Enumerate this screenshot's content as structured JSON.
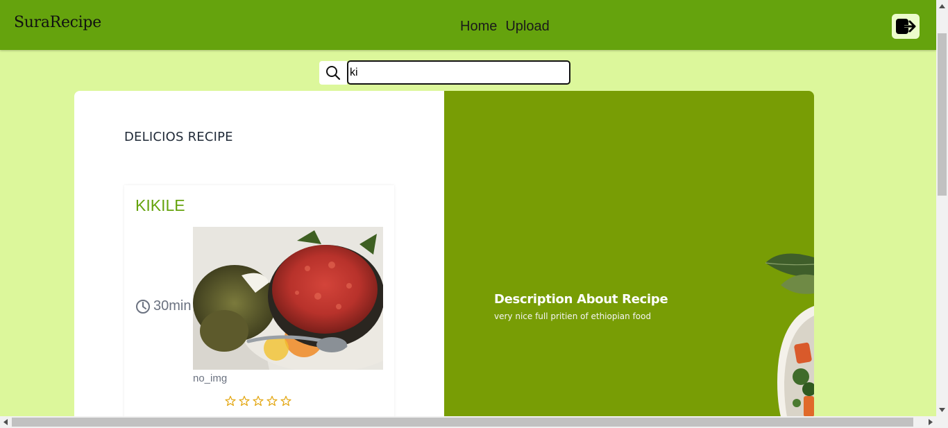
{
  "navbar": {
    "brand": "SuraRecipe",
    "links": [
      "Home",
      "Upload"
    ],
    "logout_icon": "logout-icon",
    "bg_color": "#65a30d"
  },
  "search": {
    "value": "ki",
    "icon": "search-icon"
  },
  "main": {
    "section_title": "DELICIOS RECIPE",
    "recipe": {
      "name": "KIKILE",
      "time": "30min",
      "image_caption": "no_img",
      "rating_stars": 5,
      "rating_filled": 0
    },
    "description": {
      "title": "Description About Recipe",
      "text": "very nice full pritien of ethiopian food"
    },
    "accent_color": "#789d05"
  }
}
